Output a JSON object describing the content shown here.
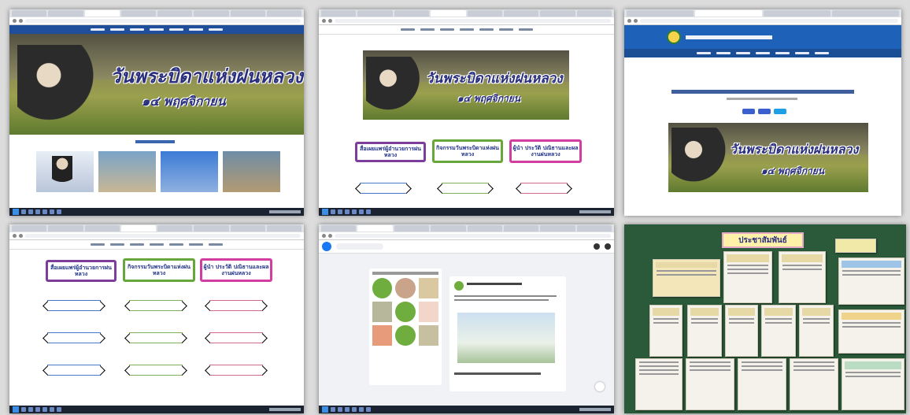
{
  "banner": {
    "title": "วันพระบิดาแห่งฝนหลวง",
    "date_first": "๑๔ พฤศจิกายน",
    "date_other": "๑๔ พฤศจิกายน"
  },
  "nav_buttons": [
    {
      "label": "สื่อเผยแพร่ผู้อำนวยการฝนหลวง",
      "color": "#7c3e9a"
    },
    {
      "label": "กิจกรรมวันพระบิดาแห่งฝนหลวง",
      "color": "#66a63b"
    },
    {
      "label": "ผู้นำ ประวัติ ปณิธานและผลงานฝนหลวง",
      "color": "#d23ea0"
    }
  ],
  "board": {
    "header": "ประชาสัมพันธ์"
  },
  "colors": {
    "nav_blue": "#1f4f9a",
    "board_green": "#2a5a3a",
    "title_ink": "#2a2f7e"
  }
}
